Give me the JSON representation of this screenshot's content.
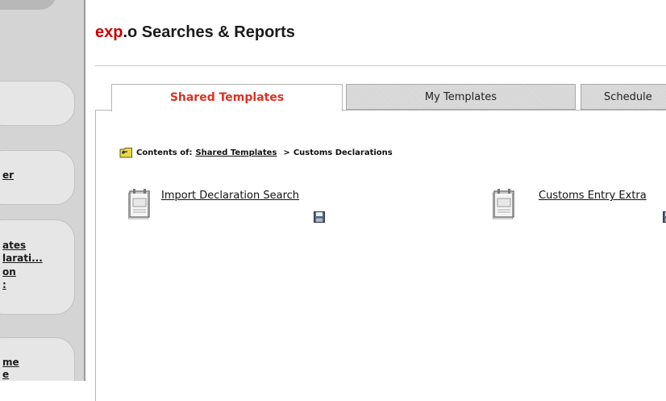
{
  "app": {
    "brand": "exp",
    "title_rest": ".o Searches & Reports"
  },
  "sidebar": {
    "items": [
      {
        "label": "er"
      },
      {
        "label": "ates"
      },
      {
        "label": "larati..."
      },
      {
        "label": "on"
      },
      {
        "label": ":"
      },
      {
        "label": "me"
      },
      {
        "label": "e"
      }
    ]
  },
  "tabs": [
    {
      "label": "Shared Templates",
      "active": true
    },
    {
      "label": "My Templates",
      "active": false
    },
    {
      "label": "Schedule",
      "active": false
    }
  ],
  "breadcrumb": {
    "prefix": "Contents of:",
    "root_link": "Shared Templates",
    "separator": ">",
    "current": "Customs Declarations"
  },
  "templates": [
    {
      "name": "Import Declaration Search",
      "icon": "report-document-icon",
      "action_icon": "save-icon"
    },
    {
      "name": "Customs Entry Extra",
      "icon": "report-document-icon",
      "action_icon": "save-icon"
    }
  ],
  "colors": {
    "brand": "#cc0000",
    "active_tab": "#e03020",
    "sidebar_bg": "#d4d4d4"
  }
}
